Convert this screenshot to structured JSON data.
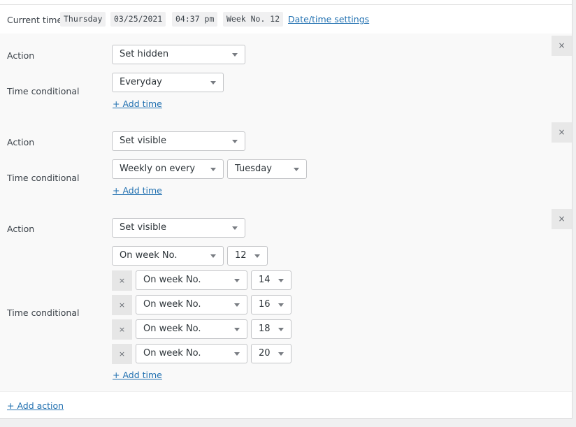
{
  "current_time": {
    "label": "Current time",
    "day": "Thursday",
    "date": "03/25/2021",
    "time": "04:37 pm",
    "week": "Week No. 12",
    "settings_link": "Date/time settings"
  },
  "labels": {
    "action": "Action",
    "time_conditional": "Time conditional",
    "add_time": "+ Add time",
    "add_action": "+ Add action",
    "remove_symbol": "×"
  },
  "rules": [
    {
      "action": "Set hidden",
      "condition": "Everyday"
    },
    {
      "action": "Set visible",
      "condition": "Weekly on every",
      "day": "Tuesday"
    },
    {
      "action": "Set visible",
      "condition": "On week No.",
      "week": "12",
      "extra": [
        {
          "condition": "On week No.",
          "week": "14"
        },
        {
          "condition": "On week No.",
          "week": "16"
        },
        {
          "condition": "On week No.",
          "week": "18"
        },
        {
          "condition": "On week No.",
          "week": "20"
        }
      ]
    }
  ]
}
